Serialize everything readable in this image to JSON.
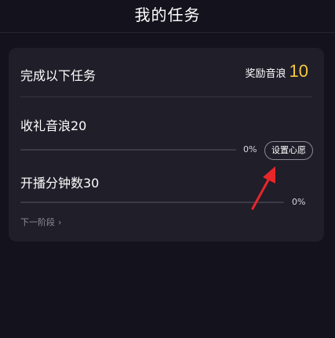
{
  "header": {
    "title": "我的任务"
  },
  "card": {
    "heading": "完成以下任务",
    "reward_label": "奖励音浪",
    "reward_value": "10",
    "tasks": [
      {
        "title": "收礼音浪20",
        "progress": 0,
        "progress_text": "0%",
        "action_label": "设置心愿"
      },
      {
        "title": "开播分钟数30",
        "progress": 0,
        "progress_text": "0%"
      }
    ],
    "next_stage_label": "下一阶段",
    "next_stage_icon": "chevron-right-icon"
  },
  "annotation": {
    "icon": "red-arrow-icon",
    "color": "#e8262a"
  },
  "colors": {
    "background": "#14131d",
    "card": "#1f1e29",
    "accent": "#f7c83a",
    "track": "#3a3946"
  }
}
